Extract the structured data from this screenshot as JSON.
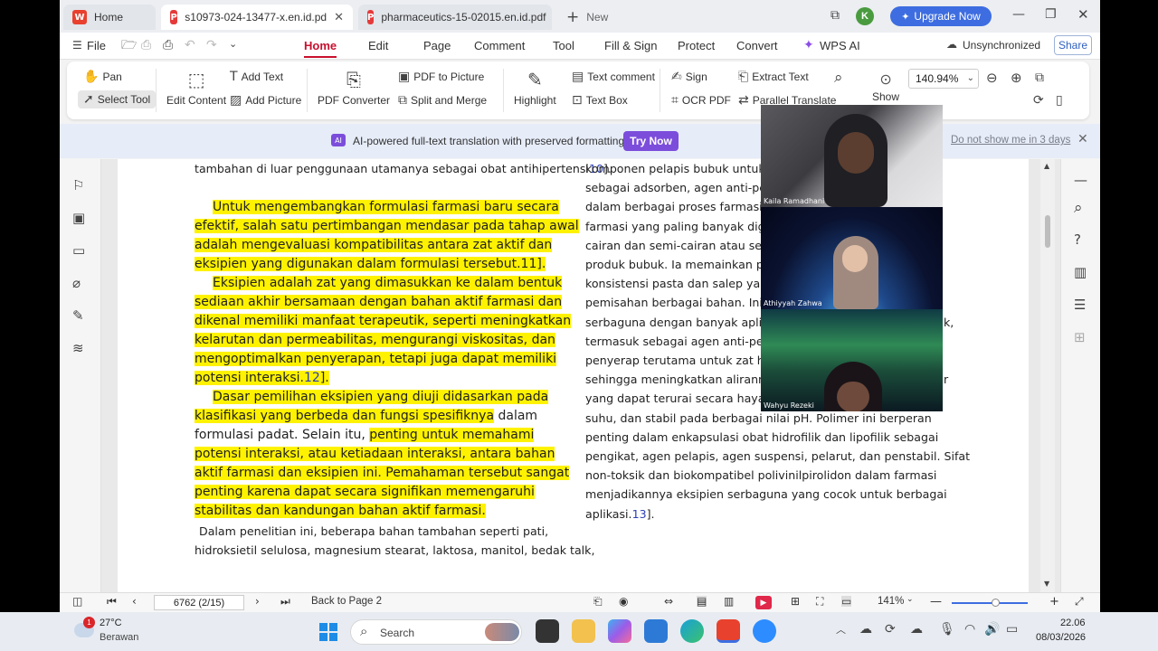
{
  "tabs": {
    "home": "Home",
    "doc1": "s10973-024-13477-x.en.id.pd",
    "doc2": "pharmaceutics-15-02015.en.id.pdf",
    "new": "New",
    "upgrade": "Upgrade Now",
    "avatar": "K"
  },
  "menu": {
    "file": "File",
    "items": [
      "Home",
      "Edit",
      "Page",
      "Comment",
      "Tool",
      "Fill & Sign",
      "Protect",
      "Convert"
    ],
    "wps_ai": "WPS AI",
    "sync": "Unsynchronized",
    "share": "Share"
  },
  "toolbar": {
    "pan": "Pan",
    "select": "Select Tool",
    "edit_content": "Edit Content",
    "add_text": "Add Text",
    "add_picture": "Add Picture",
    "pdf_converter": "PDF Converter",
    "pdf_to_picture": "PDF to Picture",
    "split_merge": "Split and Merge",
    "highlight": "Highlight",
    "text_comment": "Text comment",
    "text_box": "Text Box",
    "sign": "Sign",
    "ocr": "OCR PDF",
    "extract_text": "Extract Text",
    "parallel_translate": "Parallel Translate",
    "show": "Show",
    "zoom": "140.94%"
  },
  "banner": {
    "text": "AI-powered full-text translation with preserved formatting.",
    "try": "Try Now",
    "dismiss": "Do not show me in 3 days"
  },
  "left_column": [
    {
      "t": "tambahan di luar penggunaan utamanya sebagai obat antihipertensi",
      "ref": "10",
      "tail": "].",
      "hl": false,
      "big": false
    },
    {
      "t": "Untuk mengembangkan formulasi farmasi baru secara",
      "hl": true,
      "big": true
    },
    {
      "t": "efektif, salah satu pertimbangan mendasar pada tahap awal",
      "hl": true,
      "big": true
    },
    {
      "t": "adalah mengevaluasi kompatibilitas antara zat aktif dan",
      "hl": true,
      "big": true
    },
    {
      "t": "eksipien yang digunakan dalam formulasi tersebut.11].",
      "hl": true,
      "big": true
    },
    {
      "t": "Eksipien adalah zat yang dimasukkan ke dalam bentuk",
      "hl": true,
      "big": true
    },
    {
      "t": "sediaan akhir bersamaan dengan bahan aktif farmasi dan",
      "hl": true,
      "big": true
    },
    {
      "t": "dikenal memiliki manfaat terapeutik, seperti meningkatkan",
      "hl": true,
      "big": true
    },
    {
      "t": "kelarutan dan permeabilitas, mengurangi viskositas, dan",
      "hl": true,
      "big": true
    },
    {
      "t": "mengoptimalkan penyerapan, tetapi juga dapat memiliki",
      "hl": true,
      "big": true
    },
    {
      "t": "potensi interaksi.",
      "ref": "12",
      "tail": "].",
      "hl": true,
      "big": true
    },
    {
      "t": "Dasar pemilihan eksipien yang diuji didasarkan pada",
      "hl": true,
      "big": true
    },
    {
      "t": "klasifikasi yang berbeda dan fungsi spesifiknya",
      "tail": " dalam",
      "hl": true,
      "big": true
    },
    {
      "pre": "formulasi padat. Selain itu, ",
      "t": "penting untuk memahami",
      "hl": true,
      "big": true
    },
    {
      "t": "potensi interaksi, atau ketiadaan interaksi, antara bahan",
      "hl": true,
      "big": true
    },
    {
      "t": "aktif farmasi dan eksipien ini. Pemahaman tersebut sangat",
      "hl": true,
      "big": true
    },
    {
      "t": "penting karena dapat secara signifikan memengaruhi",
      "hl": true,
      "big": true
    },
    {
      "t": "stabilitas dan kandungan bahan aktif farmasi.",
      "hl": true,
      "big": true
    },
    {
      "t": "Dalam penelitian ini, beberapa bahan tambahan seperti pati,",
      "hl": false,
      "big": false
    },
    {
      "t": "hidroksietil selulosa, magnesium stearat, laktosa, manitol, bedak talk,",
      "hl": false,
      "big": false
    }
  ],
  "right_column": [
    "komponen pelapis bubuk untuk",
    "sebagai adsorben, agen anti-pen",
    "dalam berbagai proses farmasi.",
    "farmasi yang paling banyak digu",
    "cairan dan semi-cairan atau seba",
    "produk bubuk. Ia memainkan pe",
    "konsistensi pasta dan salep yang",
    "pemisahan berbagai bahan. Ini a",
    "serbaguna dengan banyak aplika",
    "termasuk sebagai agen anti-peng",
    "penyerap terutama untuk zat hig",
    "sehingga meningkatkan alirannya",
    "yang dapat terurai secara hayati",
    "suhu, dan stabil pada berbagai nilai pH. Polimer ini berperan",
    "penting dalam enkapsulasi obat hidrofilik dan lipofilik sebagai",
    "pengikat, agen pelapis, agen suspensi, pelarut, dan penstabil. Sifat",
    "non-toksik dan biokompatibel polivinilpirolidon dalam farmasi",
    "menjadikannya eksipien serbaguna yang cocok untuk berbagai"
  ],
  "right_last": {
    "t": "aplikasi.",
    "ref": "13",
    "tail": "]."
  },
  "right_partial": {
    "k": "k,",
    "r": "r"
  },
  "participants": [
    "Kaila Ramadhani",
    "Athiyyah Zahwa",
    "Wahyu Rezeki"
  ],
  "status": {
    "page": "6762 (2/15)",
    "back": "Back to Page 2",
    "zoom": "141%"
  },
  "taskbar": {
    "temp": "27°C",
    "weather": "Berawan",
    "search": "Search",
    "time": "22.06",
    "date": "08/03/2026",
    "badge": "1"
  },
  "colors": {
    "accent": "#c8102e",
    "highlight": "#fff200",
    "brand_blue": "#3d6de0",
    "try_now": "#7c4ddb"
  }
}
